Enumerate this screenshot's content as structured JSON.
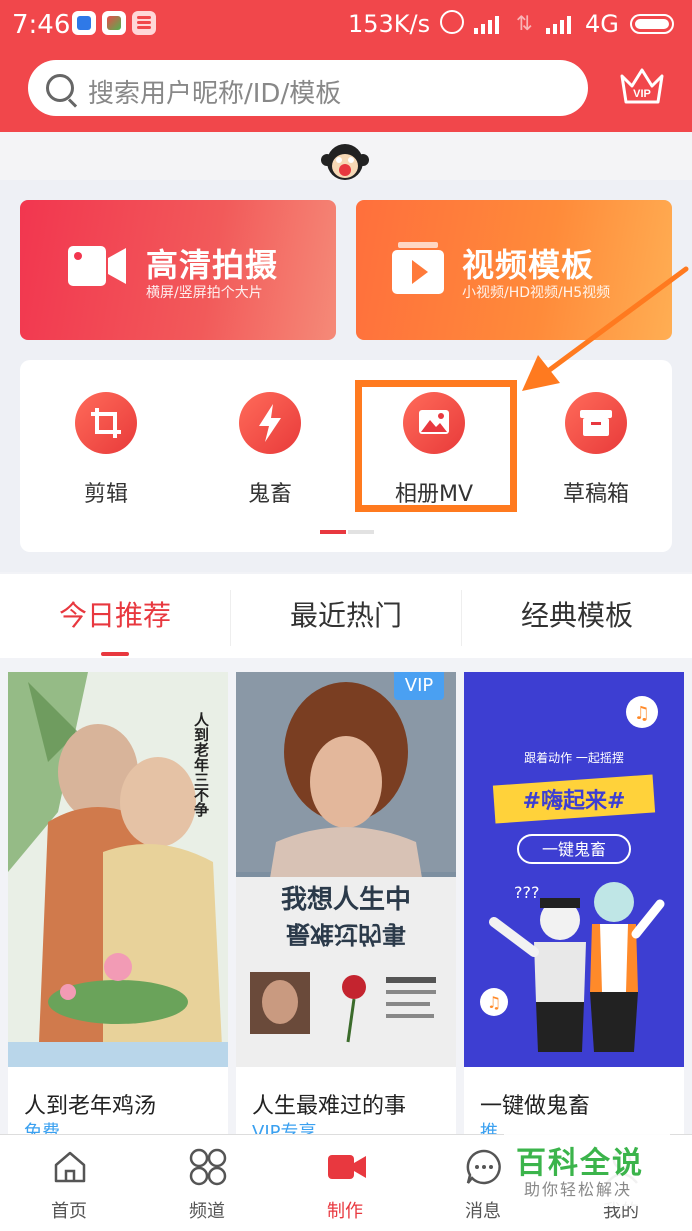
{
  "status_bar": {
    "time": "7:46",
    "net_speed": "153K/s",
    "network_type": "4G"
  },
  "header": {
    "search_placeholder": "搜索用户昵称/ID/模板",
    "vip_label": "VIP"
  },
  "feature_cards": [
    {
      "title": "高清拍摄",
      "subtitle": "横屏/竖屏拍个大片",
      "icon": "video-camera-icon"
    },
    {
      "title": "视频模板",
      "subtitle": "小视频/HD视频/H5视频",
      "icon": "play-icon"
    }
  ],
  "tools": [
    {
      "label": "剪辑",
      "icon": "crop-icon"
    },
    {
      "label": "鬼畜",
      "icon": "lightning-icon"
    },
    {
      "label": "相册MV",
      "icon": "photo-album-icon"
    },
    {
      "label": "草稿箱",
      "icon": "draft-box-icon"
    }
  ],
  "tabs": [
    {
      "label": "今日推荐",
      "active": true
    },
    {
      "label": "最近热门",
      "active": false
    },
    {
      "label": "经典模板",
      "active": false
    }
  ],
  "templates": [
    {
      "name": "人到老年鸡汤",
      "badge": "免费",
      "vip": false,
      "poster_text": "人到老年三不争"
    },
    {
      "name": "人生最难过的事",
      "badge": "VIP专享",
      "vip": true,
      "vip_tag": "VIP",
      "poster_text": "我想人生中",
      "poster_text2": "最难过的事"
    },
    {
      "name": "一键做鬼畜",
      "badge": "推",
      "vip": false,
      "poster_top": "跟着动作 一起摇摆",
      "poster_text": "#嗨起来#",
      "poster_button": "一键鬼畜"
    }
  ],
  "bottom_nav": [
    {
      "label": "首页",
      "icon": "home-icon",
      "active": false
    },
    {
      "label": "频道",
      "icon": "channels-icon",
      "active": false
    },
    {
      "label": "制作",
      "icon": "video-camera-icon",
      "active": true
    },
    {
      "label": "消息",
      "icon": "message-icon",
      "active": false
    },
    {
      "label": "我的",
      "icon": "profile-icon",
      "active": false
    }
  ],
  "watermark": {
    "title": "百科全说",
    "subtitle": "助你轻松解决"
  },
  "colors": {
    "brand_red": "#f1474b",
    "accent_orange": "#ff7a1f",
    "vip_blue": "#4aa0f2"
  }
}
